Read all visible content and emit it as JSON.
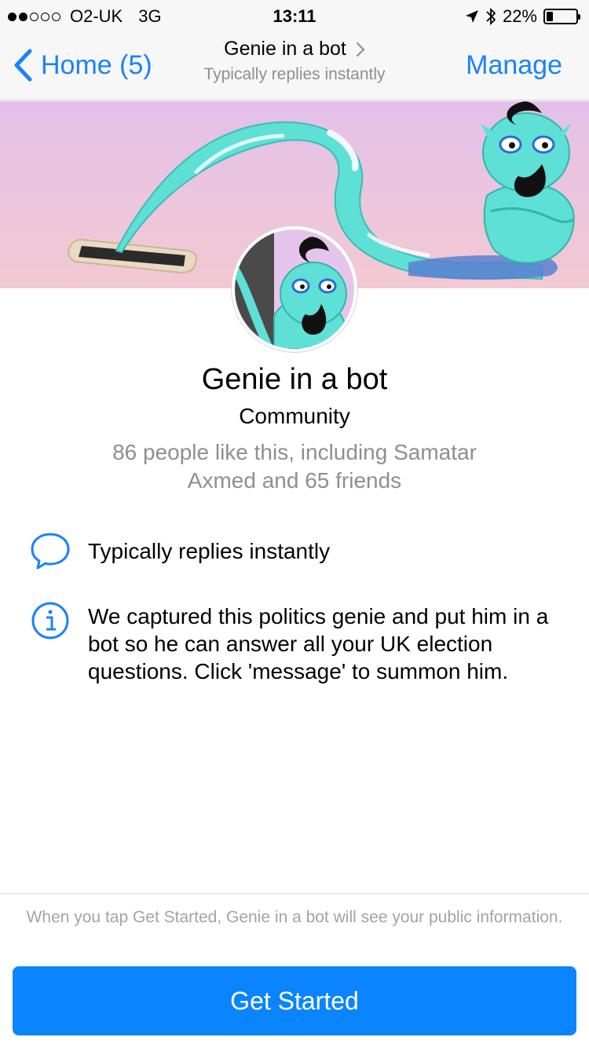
{
  "status_bar": {
    "carrier": "O2-UK",
    "network": "3G",
    "time": "13:11",
    "battery_percent_label": "22%",
    "battery_level": 0.22,
    "signal_bars_filled": 2,
    "signal_bars_total": 5
  },
  "nav": {
    "back_label": "Home (5)",
    "title": "Genie in a bot",
    "subtitle": "Typically replies instantly",
    "manage_label": "Manage"
  },
  "profile": {
    "name": "Genie in a bot",
    "category": "Community",
    "likes_text": "86 people like this, including Samatar Axmed and 65 friends"
  },
  "info": {
    "replies_text": "Typically replies instantly",
    "about_text": "We captured this politics genie and put him in a bot so he can answer all your UK election questions. Click 'message' to summon him."
  },
  "footer": {
    "note": "When you tap Get Started, Genie in a bot will see your public information.",
    "button_label": "Get Started"
  },
  "colors": {
    "accent": "#1a82fb",
    "button": "#0a84ff",
    "genie": "#5fe0d6",
    "cover_top": "#e3c0ea",
    "cover_bottom": "#f2c8d2"
  },
  "icons": [
    "back-chevron-icon",
    "chevron-right-icon",
    "location-arrow-icon",
    "bluetooth-icon",
    "battery-icon",
    "speech-bubble-icon",
    "info-icon"
  ]
}
